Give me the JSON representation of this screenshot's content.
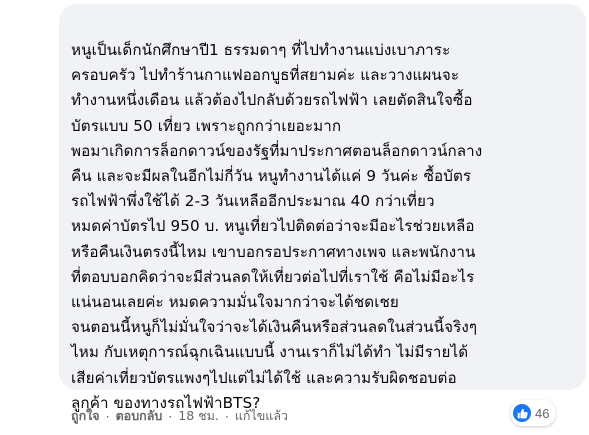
{
  "comment": {
    "lines": [
      "หนูเป็นเด็กนักศึกษาปี1 ธรรมดาๆ ที่ไปทำงานแบ่งเบาภาระ",
      "ครอบครัว ไปทำร้านกาแฟออกบูธที่สยามค่ะ และวางแผนจะ",
      "ทำงานหนึ่งเดือน แล้วต้องไปกลับด้วยรถไฟฟ้า เลยตัดสินใจซื้อ",
      "บัตรแบบ 50 เที่ยว เพราะถูกกว่าเยอะมาก",
      "พอมาเกิดการล็อกดาวน์ของรัฐที่มาประกาศตอนล็อกดาวน์กลาง",
      "คืน และจะมีผลในอีกไม่กี่วัน หนูทำงานได้แค่ 9 วันค่ะ ซื้อบัตร",
      "รถไฟฟ้าพึ่งใช้ได้ 2-3 วันเหลืออีกประมาณ 40 กว่าเที่ยว",
      "หมดค่าบัตรไป 950 บ. หนูเที่ยวไปติดต่อว่าจะมีอะไรช่วยเหลือ",
      "หรือคืนเงินตรงนี้ไหม เขาบอกรอประกาศทางเพจ และพนักงาน",
      "ที่ตอบบอกคิดว่าจะมีส่วนลดให้เที่ยวต่อไปที่เราใช้ คือไม่มีอะไร",
      "แน่นอนเลยค่ะ หมดความมั่นใจมากว่าจะได้ชดเชย",
      "จนตอนนี้หนูก็ไม่มั่นใจว่าจะได้เงินคืนหรือส่วนลดในส่วนนี้จริงๆ",
      "ไหม กับเหตุการณ์ฉุกเฉินแบบนี้ งานเราก็ไม่ได้ทำ ไม่มีรายได้",
      "เสียค่าเที่ยวบัตรแพงๆไปแต่ไม่ได้ใช้ และความรับผิดชอบต่อ",
      "ลูกค้า ของทางรถไฟฟ้าBTS?"
    ]
  },
  "actions": {
    "like": "ถูกใจ",
    "reply": "ตอบกลับ",
    "time": "18 ชม.",
    "edited": "แก้ไขแล้ว",
    "separator": "·"
  },
  "reactions": {
    "icon": "thumbs-up-icon",
    "count": "46",
    "color": "#1877f2"
  }
}
